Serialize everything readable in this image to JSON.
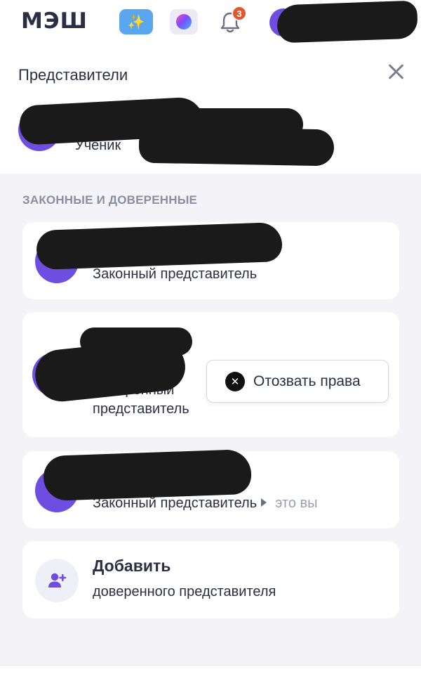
{
  "app": {
    "logo": "МЭШ"
  },
  "header": {
    "notification_count": "3"
  },
  "sheet": {
    "title": "Представители",
    "student": {
      "role": "Ученик"
    },
    "section_label": "ЗАКОННЫЕ И ДОВЕРЕННЫЕ",
    "representatives": [
      {
        "role": "Законный представитель"
      },
      {
        "role_line1": "Доверенный",
        "role_line2": "представитель",
        "action": "Отозвать права"
      },
      {
        "role": "Законный представитель",
        "self_note": "это вы"
      }
    ],
    "add": {
      "title": "Добавить",
      "subtitle": "доверенного представителя"
    }
  },
  "colors": {
    "accent": "#6d4ee0",
    "badge": "#e2572b",
    "sheet_bg": "#f3f3f8"
  }
}
